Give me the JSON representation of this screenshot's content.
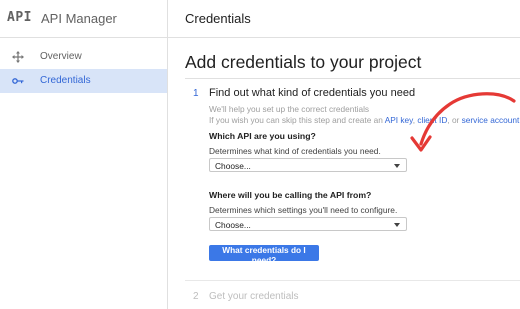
{
  "sidebar": {
    "logo": "API",
    "app_title": "API Manager",
    "items": [
      {
        "label": "Overview",
        "icon": "overview-icon"
      },
      {
        "label": "Credentials",
        "icon": "key-icon"
      }
    ]
  },
  "topbar": {
    "title": "Credentials"
  },
  "main": {
    "title": "Add credentials to your project",
    "step1": {
      "number": "1",
      "title": "Find out what kind of credentials you need",
      "intro": "We'll help you set up the correct credentials",
      "skip_prefix": "If you wish you can skip this step and create an",
      "links": {
        "api_key": "API key",
        "client_id": "client ID",
        "service_account": "service account"
      },
      "sep": ",",
      "or": ", or",
      "q1": "Which API are you using?",
      "q1_hint": "Determines what kind of credentials you need.",
      "select1": "Choose...",
      "q2": "Where will you be calling the API from?",
      "q2_hint": "Determines which settings you'll need to configure.",
      "select2": "Choose...",
      "button": "What credentials do I need?"
    },
    "step2": {
      "number": "2",
      "title": "Get your credentials"
    }
  },
  "colors": {
    "accent": "#3367d6",
    "button": "#3b78e7",
    "arrow": "#e53935",
    "selected_bg": "#d8e4f8"
  }
}
